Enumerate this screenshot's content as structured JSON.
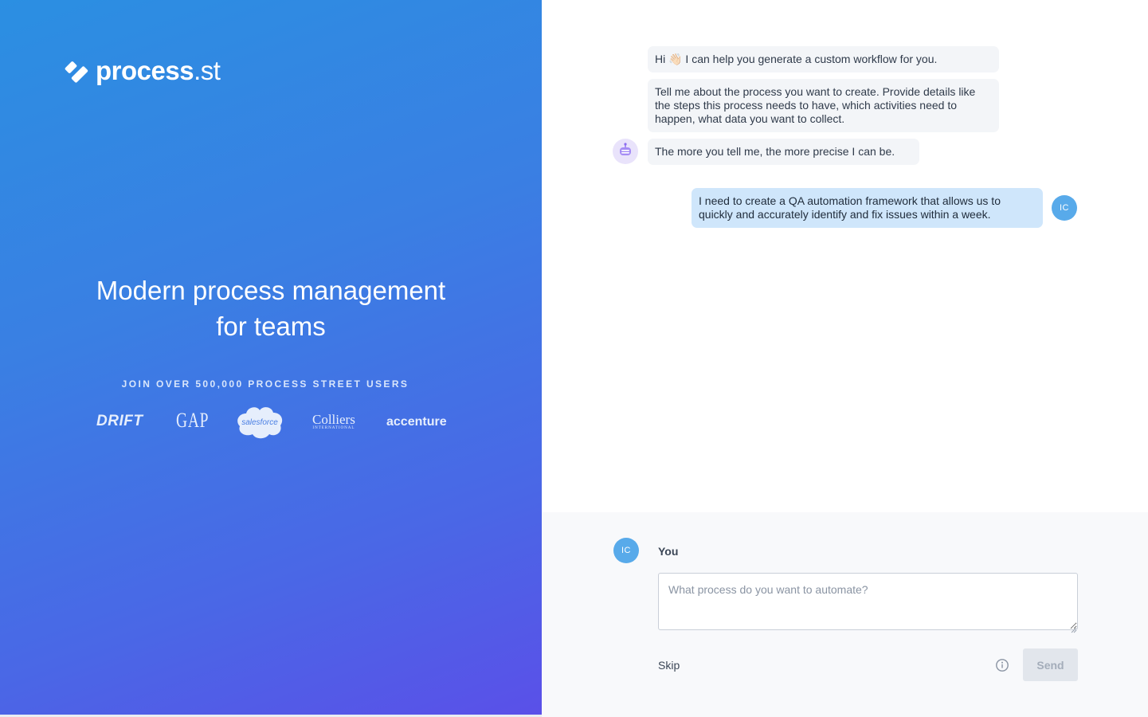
{
  "brand": {
    "logo_main": "process",
    "logo_suffix": ".st"
  },
  "hero": {
    "headline_line1": "Modern process management",
    "headline_line2": "for teams",
    "join_text": "JOIN OVER 500,000 PROCESS STREET USERS",
    "customers": [
      {
        "name": "DRIFT"
      },
      {
        "name": "GAP"
      },
      {
        "name": "salesforce"
      },
      {
        "name": "Colliers",
        "sub": "INTERNATIONAL"
      },
      {
        "name": "accenture"
      }
    ]
  },
  "chat": {
    "bot_messages": [
      "Hi 👋🏻 I can help you generate a custom workflow for you.",
      "Tell me about the process you want to create. Provide details like the steps this process needs to have, which activities need to happen, what data you want to collect.",
      "The more you tell me, the more precise I can be."
    ],
    "user_message": "I need to create a QA automation framework that allows us to quickly and accurately identify and fix issues within a week.",
    "user_initials": "IC"
  },
  "composer": {
    "user_initials": "IC",
    "user_label": "You",
    "placeholder": "What process do you want to automate?",
    "value": "",
    "skip_label": "Skip",
    "send_label": "Send"
  },
  "colors": {
    "gradient_start": "#2b8fe2",
    "gradient_end": "#5a50e8",
    "user_bubble": "#cfe6fb",
    "bot_bubble": "#f3f5f8",
    "avatar": "#58aaea"
  },
  "icons": {
    "logo": "process-street-logo-icon",
    "bot": "robot-icon",
    "info": "info-circle-icon"
  }
}
